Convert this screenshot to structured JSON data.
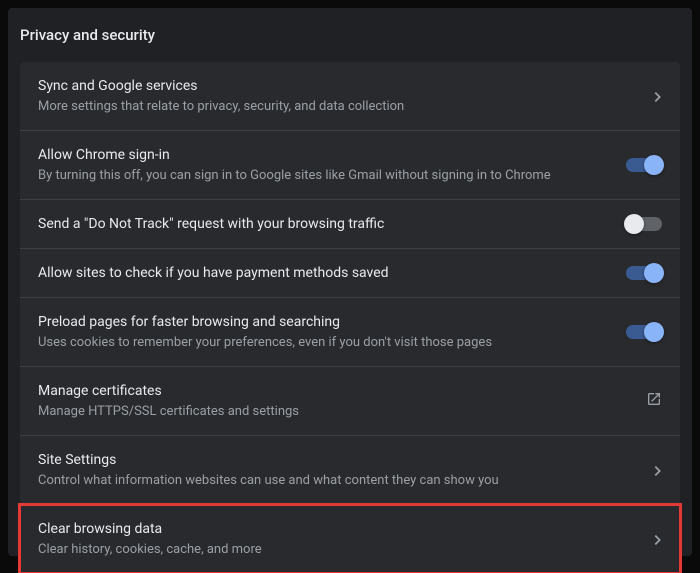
{
  "section_title": "Privacy and security",
  "rows": [
    {
      "title": "Sync and Google services",
      "subtitle": "More settings that relate to privacy, security, and data collection",
      "action": "chevron"
    },
    {
      "title": "Allow Chrome sign-in",
      "subtitle": "By turning this off, you can sign in to Google sites like Gmail without signing in to Chrome",
      "action": "toggle-on"
    },
    {
      "title": "Send a \"Do Not Track\" request with your browsing traffic",
      "subtitle": "",
      "action": "toggle-off"
    },
    {
      "title": "Allow sites to check if you have payment methods saved",
      "subtitle": "",
      "action": "toggle-on"
    },
    {
      "title": "Preload pages for faster browsing and searching",
      "subtitle": "Uses cookies to remember your preferences, even if you don't visit those pages",
      "action": "toggle-on"
    },
    {
      "title": "Manage certificates",
      "subtitle": "Manage HTTPS/SSL certificates and settings",
      "action": "external"
    },
    {
      "title": "Site Settings",
      "subtitle": "Control what information websites can use and what content they can show you",
      "action": "chevron"
    },
    {
      "title": "Clear browsing data",
      "subtitle": "Clear history, cookies, cache, and more",
      "action": "chevron",
      "highlight": true
    }
  ]
}
